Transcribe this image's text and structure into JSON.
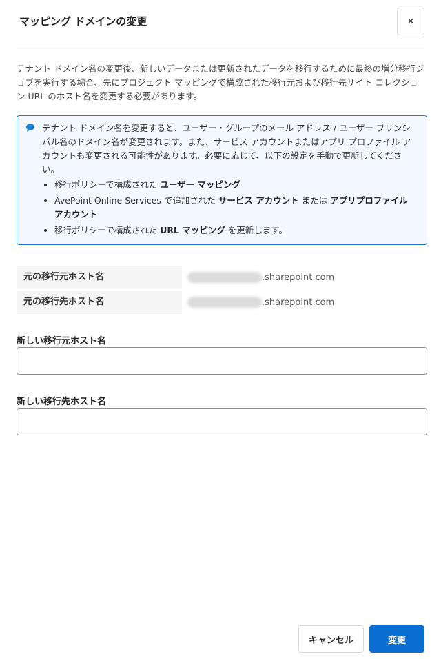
{
  "dialog": {
    "title": "マッピング ドメインの変更",
    "close_label": "×"
  },
  "description": "テナント ドメイン名の変更後、新しいデータまたは更新されたデータを移行するために最終の増分移行ジョブを実行する場合、先にプロジェクト マッピングで構成された移行元および移行先サイト コレクション URL のホスト名を変更する必要があります。",
  "info": {
    "icon": "speech-bubble-icon",
    "text": "テナント ドメイン名を変更すると、ユーザー・グループのメール アドレス / ユーザー プリンシパル名のドメイン名が変更されます。また、サービス アカウントまたはアプリ プロファイル アカウントも変更される可能性があります。必要に応じて、以下の設定を手動で更新してください。",
    "items": [
      {
        "pre": "移行ポリシーで構成された ",
        "bold": "ユーザー マッピング",
        "mid": "",
        "bold2": "",
        "post": ""
      },
      {
        "pre": "AvePoint Online Services で追加された ",
        "bold": "サービス アカウント",
        "mid": " または ",
        "bold2": "アプリプロファイル アカウント",
        "post": ""
      },
      {
        "pre": "移行ポリシーで構成された ",
        "bold": "URL マッピング",
        "mid": "",
        "bold2": "",
        "post": " を更新します。"
      }
    ]
  },
  "original": {
    "source_label": "元の移行元ホスト名",
    "source_suffix": ".sharepoint.com",
    "target_label": "元の移行先ホスト名",
    "target_suffix": ".sharepoint.com"
  },
  "form": {
    "new_source_label": "新しい移行元ホスト名",
    "new_source_value": "",
    "new_target_label": "新しい移行先ホスト名",
    "new_target_value": ""
  },
  "footer": {
    "cancel_label": "キャンセル",
    "submit_label": "変更"
  },
  "colors": {
    "primary": "#0a6ed1",
    "info_border": "#1a7fd4",
    "info_bg": "#f2f8fd"
  }
}
